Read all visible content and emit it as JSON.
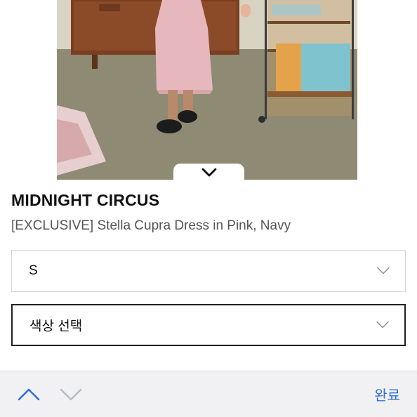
{
  "product": {
    "brand": "MIDNIGHT CIRCUS",
    "name": "[EXCLUSIVE] Stella Cupra Dress in Pink, Navy"
  },
  "options": {
    "size_value": "S",
    "color_placeholder": "색상 선택"
  },
  "toolbar": {
    "done_label": "완료"
  },
  "icons": {
    "collapse": "chevron-down-icon",
    "select_arrow": "chevron-down-icon",
    "prev": "chevron-up-icon",
    "next": "chevron-down-icon"
  },
  "colors": {
    "accent": "#2f6fd6",
    "toolbar_bg": "#f1f1f4",
    "active_border": "#222222",
    "inactive_border": "#d6d6d6"
  }
}
